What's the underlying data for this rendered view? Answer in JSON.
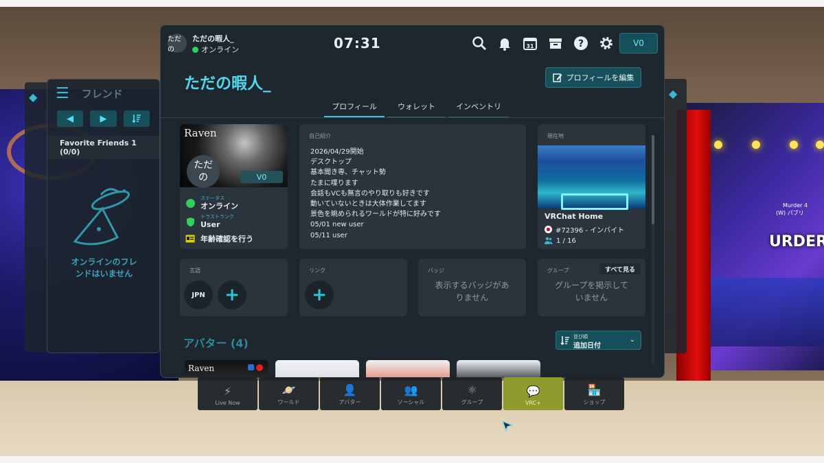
{
  "friends_panel": {
    "title": "フレンド",
    "group_label": "Favorite Friends 1 (0/0)",
    "empty_text_1": "オンラインのフレ",
    "empty_text_2": "ンドはいません"
  },
  "topbar": {
    "avatar_text": "ただの",
    "username": "ただの暇人_",
    "status": "オンライン",
    "time": "07:31",
    "currency": "V0"
  },
  "profile": {
    "display_name": "ただの暇人_",
    "edit_button": "プロフィールを編集",
    "tabs": [
      "プロフィール",
      "ウォレット",
      "インベントリ"
    ],
    "image_text": "Raven",
    "bubble_text_1": "ただ",
    "bubble_text_2": "の",
    "currency_badge": "V0",
    "status_label": "ステータス",
    "status_value": "オンライン",
    "trust_label": "トラストランク",
    "trust_value": "User",
    "age_verify": "年齢確認を行う"
  },
  "bio": {
    "label": "自己紹介",
    "text": "2026/04/29開始\nデスクトップ\n基本聞き専、チャット勢\nたまに喋ります\n会話もVCも無言のやり取りも好きです\n動いていないときは大体作業してます\n景色を眺められるワールドが特に好みです\n05/01 new user\n05/11 user"
  },
  "location": {
    "label": "現在地",
    "world_name": "VRChat Home",
    "instance": "#72396 - インバイト",
    "players": "1 / 16"
  },
  "language": {
    "label": "言語",
    "code": "JPN"
  },
  "links": {
    "label": "リンク"
  },
  "badges": {
    "label": "バッジ",
    "empty_1": "表示するバッジがあ",
    "empty_2": "りません"
  },
  "groups": {
    "label": "グループ",
    "see_all": "すべて見る",
    "empty_1": "グループを掲示して",
    "empty_2": "いません"
  },
  "avatars": {
    "heading": "アバター (4)",
    "sort_label": "並び順",
    "sort_value": "追加日付",
    "first_thumb_text": "Raven"
  },
  "dock": [
    {
      "label": "Live Now",
      "icon": "lightning-icon"
    },
    {
      "label": "ワールド",
      "icon": "planet-icon"
    },
    {
      "label": "アバター",
      "icon": "avatar-icon"
    },
    {
      "label": "ソーシャル",
      "icon": "social-icon"
    },
    {
      "label": "グループ",
      "icon": "group-icon"
    },
    {
      "label": "VRC+",
      "icon": "vrcplus-icon"
    },
    {
      "label": "ショップ",
      "icon": "shop-icon"
    }
  ],
  "world_bg": {
    "billboard": "URDER",
    "sign_line_1": "Murder 4",
    "sign_line_2": "(W) パブリ"
  },
  "colors": {
    "accent": "#3dc6dd",
    "online": "#2fd15a",
    "vrcplus": "#8f9a2c"
  }
}
